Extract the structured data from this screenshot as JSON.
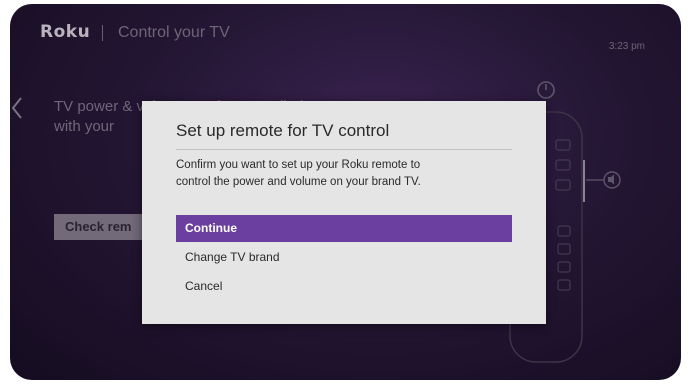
{
  "header": {
    "logo": "Roku",
    "title": "Control your TV",
    "time": "3:23 pm"
  },
  "background": {
    "text": "TV power & volume can be controlled\nwith your",
    "check_button_label": "Check rem"
  },
  "dialog": {
    "title": "Set up remote for TV control",
    "body": "Confirm you want to set up your Roku remote to\ncontrol the power and volume on your  brand TV.",
    "options": [
      {
        "label": "Continue",
        "selected": true
      },
      {
        "label": "Change TV brand",
        "selected": false
      },
      {
        "label": "Cancel",
        "selected": false
      }
    ]
  },
  "colors": {
    "accent": "#6b3fa0",
    "dialog_bg": "#e5e5e6",
    "screen_bg": "#241634"
  },
  "icons": {
    "back": "chevron-left-icon",
    "power": "power-icon",
    "volume": "volume-icon"
  }
}
